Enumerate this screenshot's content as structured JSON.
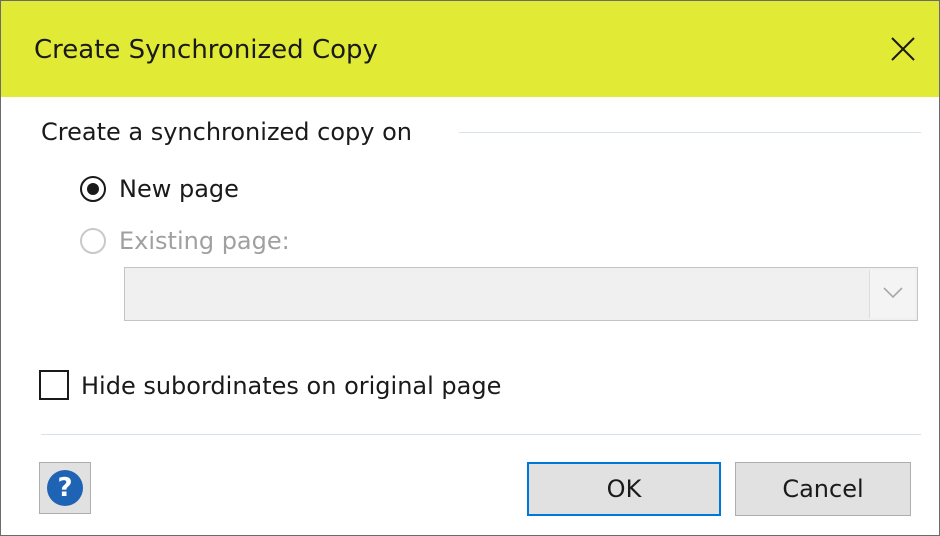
{
  "dialog": {
    "title": "Create Synchronized Copy",
    "close_icon": "close-icon",
    "titlebar_color": "#e1ea35"
  },
  "group": {
    "label": "Create a synchronized copy on",
    "options": [
      {
        "label": "New page",
        "selected": true,
        "enabled": true
      },
      {
        "label": "Existing page:",
        "selected": false,
        "enabled": false
      }
    ],
    "page_select": {
      "value": "",
      "enabled": false,
      "icon": "chevron-down-icon"
    }
  },
  "hide_subordinates": {
    "label": "Hide subordinates on original page",
    "checked": false
  },
  "footer": {
    "help_icon": "help-icon",
    "help_glyph": "?",
    "ok_label": "OK",
    "cancel_label": "Cancel",
    "accent": "#0078d7"
  }
}
